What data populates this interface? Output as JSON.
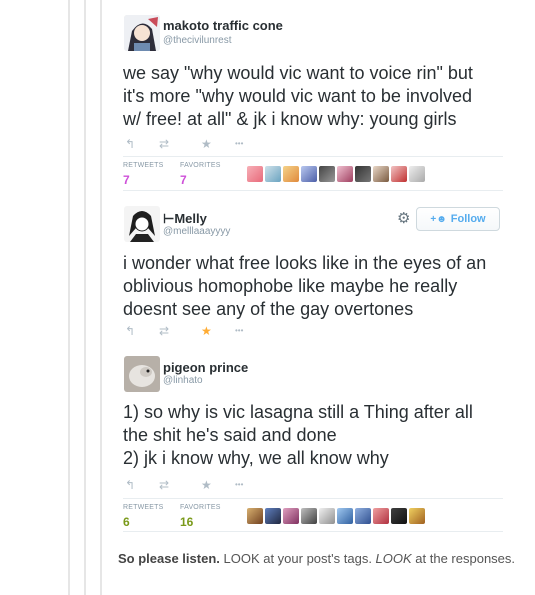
{
  "tweets": [
    {
      "name": "makoto traffic cone",
      "handle": "@thecivilunrest",
      "lines": [
        "we say \"why would vic want to voice rin\" but",
        "it's more \"why would vic want to be involved",
        "w/ free! at all\" & jk i know why: young girls"
      ],
      "retweets_label": "RETWEETS",
      "retweets": "7",
      "favorites_label": "FAVORITES",
      "favorites": "7"
    },
    {
      "name": "⊢Melly",
      "handle": "@melllaaayyyy",
      "follow_label": "Follow",
      "lines": [
        "i wonder what free looks like in the eyes of an",
        "oblivious homophobe like maybe he really",
        "doesnt see any of the gay overtones"
      ]
    },
    {
      "name": "pigeon prince",
      "handle": "@linhato",
      "lines": [
        "1) so why is vic lasagna still a Thing after all",
        "the shit he's said and done",
        "2) jk i know why, we all know why"
      ],
      "retweets_label": "RETWEETS",
      "retweets": "6",
      "favorites_label": "FAVORITES",
      "favorites": "16"
    }
  ],
  "icons": {
    "reply": "↰",
    "retweet": "⇄",
    "favorite": "★",
    "more": "•••",
    "gear": "⚙",
    "follow": "+☻"
  },
  "colors": {
    "tweet1_stats": "#ce4fd8",
    "tweet3_stats": "#7a9a1a",
    "favorited_star": "#ffac33"
  },
  "caption": {
    "bold": "So please listen.",
    "part1": " LOOK at your post's tags. ",
    "emph": "LOOK",
    "part2": " at the responses."
  }
}
